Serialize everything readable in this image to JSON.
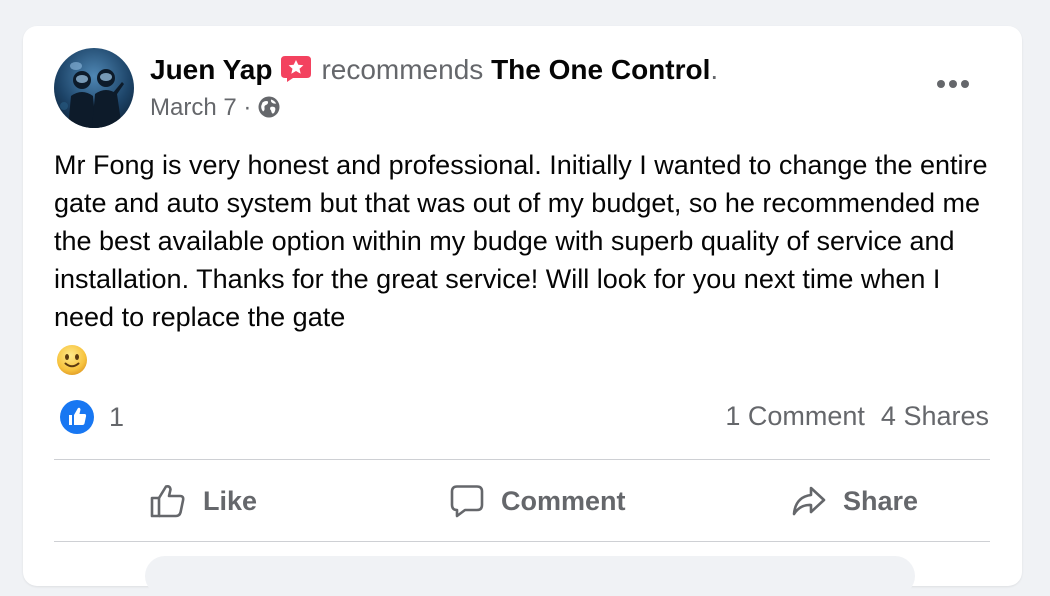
{
  "post": {
    "author": "Juen Yap",
    "action_text": "recommends",
    "page_name": "The One Control",
    "period": ".",
    "date": "March 7",
    "separator": " · ",
    "audience_icon": "globe-icon",
    "body": "Mr Fong is very honest and professional. Initially I wanted to change the entire gate and auto system but that was out of my budget, so he recommended me the best available option within my budge with superb quality of service and installation. Thanks for the great service! Will look for you next time when I need to replace the gate",
    "emoji_icon": "slightly-smiling-face-icon"
  },
  "stats": {
    "reaction_count": "1",
    "comments": "1 Comment",
    "shares": "4 Shares"
  },
  "actions": {
    "like": "Like",
    "comment": "Comment",
    "share": "Share"
  },
  "colors": {
    "brand_blue": "#1877f2",
    "recommend_badge": "#f3425f",
    "secondary_text": "#65676b",
    "primary_text": "#050505",
    "divider": "#ced0d4",
    "page_bg": "#f0f2f5"
  }
}
